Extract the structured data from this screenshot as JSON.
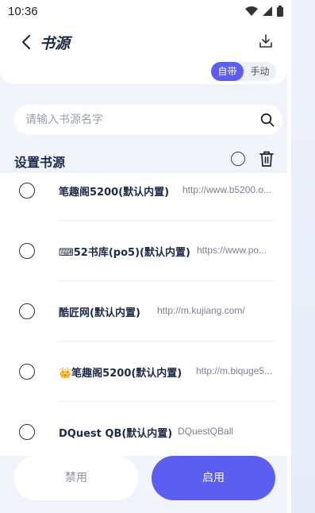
{
  "status_bar": {
    "time": "10:36"
  },
  "header": {
    "title": "书源"
  },
  "mode_toggle": {
    "options": [
      "自带",
      "手动"
    ],
    "selected": "自带"
  },
  "search": {
    "placeholder": "请输入书源名字"
  },
  "section": {
    "title": "设置书源"
  },
  "sources": [
    {
      "name": "笔趣阁5200(默认内置)",
      "url": "http://www.b5200.o..."
    },
    {
      "name": "⌨52书库(po5)(默认内置)",
      "url": "https://www.po..."
    },
    {
      "name": "酷匠网(默认内置)",
      "url": "http://m.kujiang.com/"
    },
    {
      "name": "👑笔趣阁5200(默认内置)",
      "url": "http://m.biquge5..."
    },
    {
      "name": "DQuest QB(默认内置)",
      "url": "DQuestQBall"
    }
  ],
  "actions": {
    "disable_label": "禁用",
    "enable_label": "启用"
  },
  "colors": {
    "accent": "#5b5ef0",
    "text_dark": "#1e2a4a",
    "background": "#f2f4fc"
  }
}
